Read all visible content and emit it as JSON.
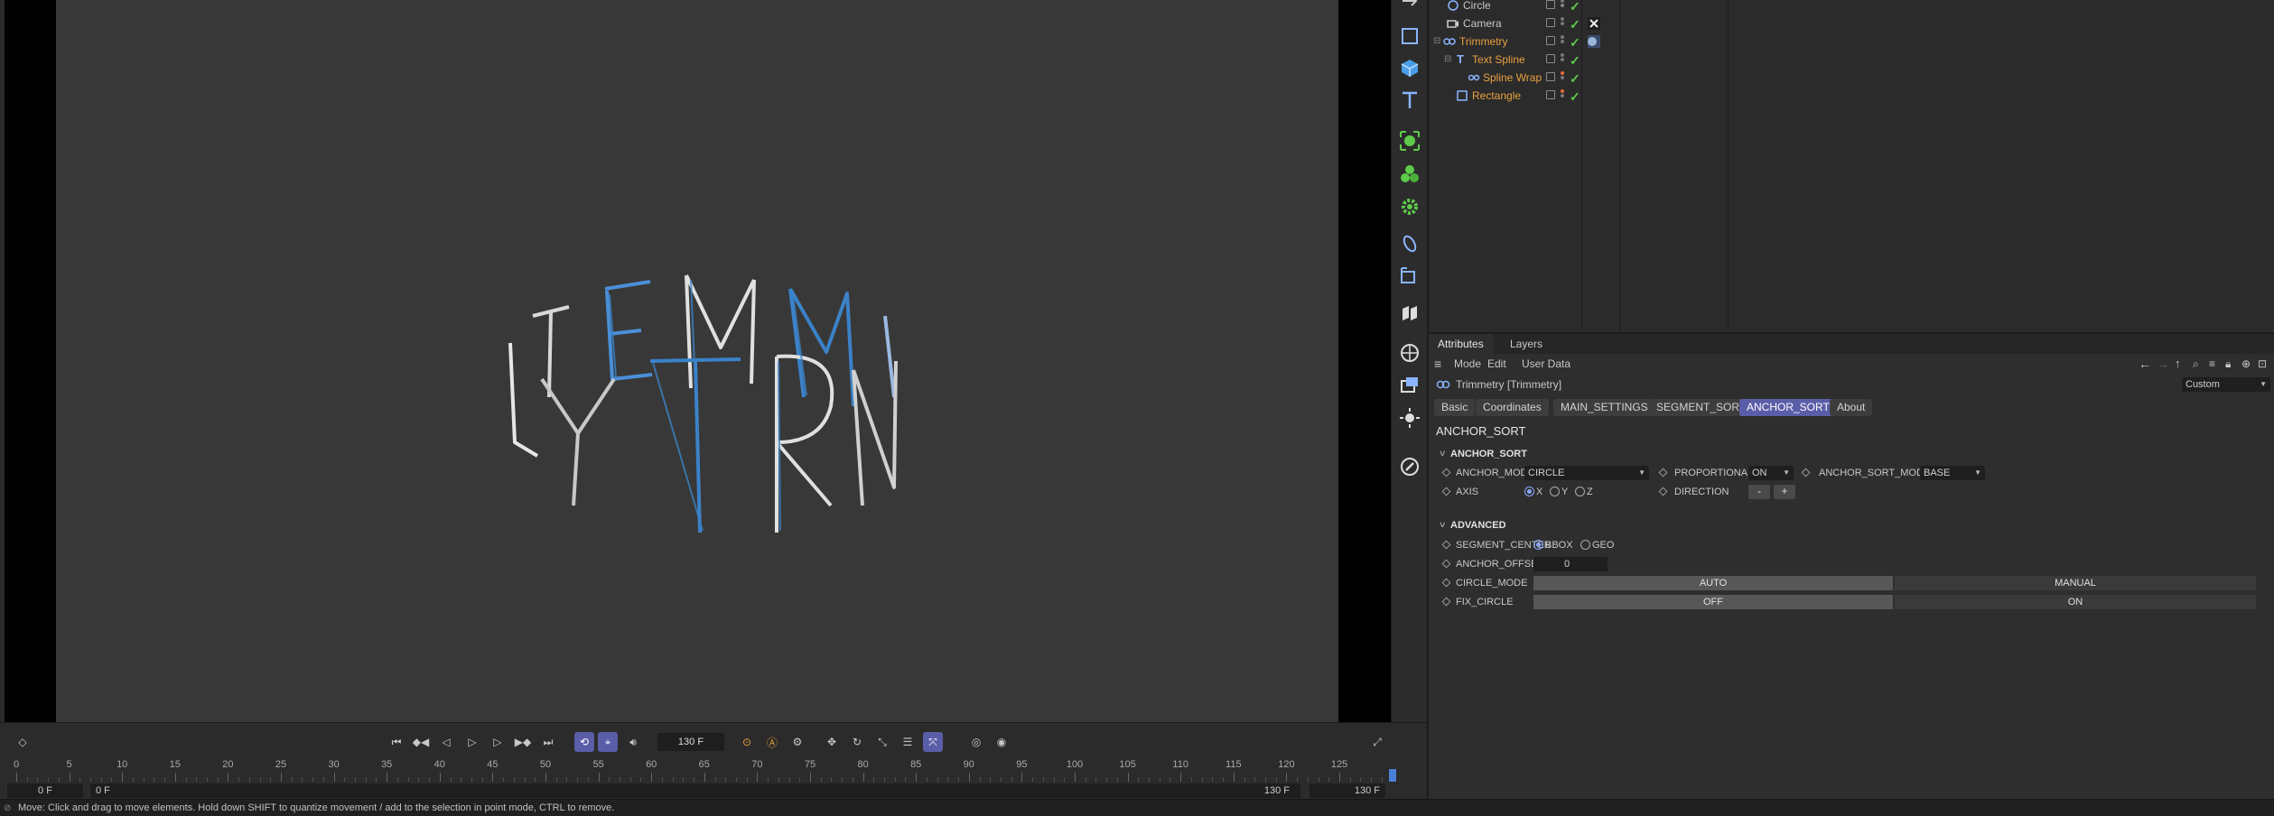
{
  "objects": [
    {
      "name": "Circle",
      "color": "#c8c8c8"
    },
    {
      "name": "Camera",
      "color": "#c8c8c8"
    },
    {
      "name": "Trimmetry",
      "color": "#e8a040"
    },
    {
      "name": "Text Spline",
      "color": "#e8a040"
    },
    {
      "name": "Spline Wrap",
      "color": "#e8a040"
    },
    {
      "name": "Rectangle",
      "color": "#e8a040"
    }
  ],
  "attributes": {
    "tabs": [
      "Attributes",
      "Layers"
    ],
    "menu": [
      "Mode",
      "Edit",
      "User Data"
    ],
    "object_title": "Trimmetry [Trimmetry]",
    "preset": "Custom",
    "pages": [
      "Basic",
      "Coordinates",
      "MAIN_SETTINGS",
      "SEGMENT_SORT",
      "ANCHOR_SORT",
      "About"
    ],
    "active_page": "ANCHOR_SORT",
    "section_title": "ANCHOR_SORT",
    "anchor_group": {
      "title": "ANCHOR_SORT",
      "anchor_mode_label": "ANCHOR_MODE",
      "anchor_mode_value": "CIRCLE",
      "proportional_label": "PROPORTIONAL",
      "proportional_value": "ON",
      "anchor_sort_mode_label": "ANCHOR_SORT_MODE",
      "anchor_sort_mode_value": "BASE",
      "axis_label": "AXIS",
      "axis_options": [
        "X",
        "Y",
        "Z"
      ],
      "direction_label": "DIRECTION",
      "direction_minus": "-",
      "direction_plus": "+"
    },
    "advanced_group": {
      "title": "ADVANCED",
      "segment_center_label": "SEGMENT_CENTER",
      "segment_center_options": [
        "BBOX",
        "GEO"
      ],
      "anchor_offset_label": "ANCHOR_OFFSET",
      "anchor_offset_value": "0",
      "circle_mode_label": "CIRCLE_MODE",
      "circle_mode_options": [
        "AUTO",
        "MANUAL"
      ],
      "fix_circle_label": "FIX_CIRCLE",
      "fix_circle_options": [
        "OFF",
        "ON"
      ]
    }
  },
  "timeline": {
    "current_frame": "130 F",
    "ruler": [
      "0",
      "5",
      "10",
      "15",
      "20",
      "25",
      "30",
      "35",
      "40",
      "45",
      "50",
      "55",
      "60",
      "65",
      "70",
      "75",
      "80",
      "85",
      "90",
      "95",
      "100",
      "105",
      "110",
      "115",
      "120",
      "125"
    ],
    "range_start": "0 F",
    "range_start2": "0 F",
    "range_end": "130 F",
    "range_end2": "130 F"
  },
  "status": "Move: Click and drag to move elements. Hold down SHIFT to quantize movement / add to the selection in point mode, CTRL to remove.",
  "colors": {
    "accent": "#5a5da8",
    "check": "#5ecb4a",
    "object_orange": "#e8a040",
    "spline_blue": "#3b82c8"
  }
}
